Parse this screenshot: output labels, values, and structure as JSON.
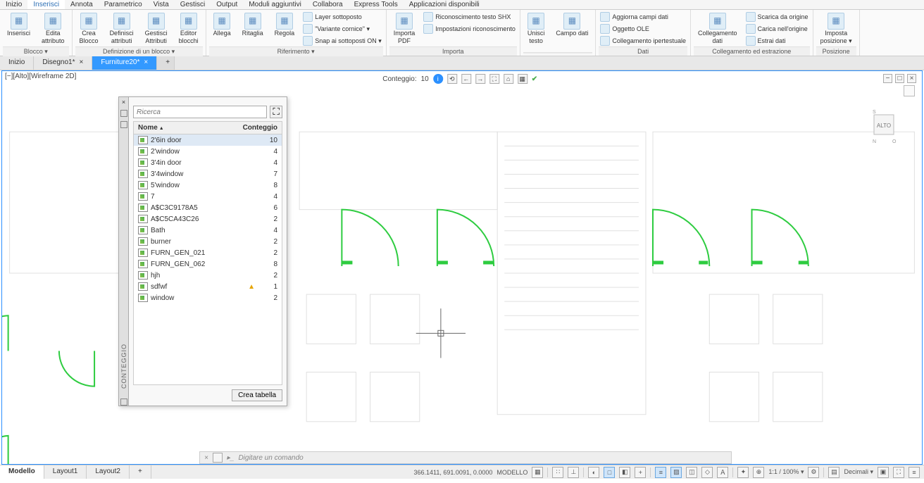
{
  "menu": [
    "Inizio",
    "Inserisci",
    "Annota",
    "Parametrico",
    "Vista",
    "Gestisci",
    "Output",
    "Moduli aggiuntivi",
    "Collabora",
    "Express Tools",
    "Applicazioni disponibili"
  ],
  "menu_active": 1,
  "ribbon": {
    "panels": [
      {
        "title": "Blocco ▾",
        "items_big": [
          [
            "Inserisci",
            ""
          ],
          [
            "Edita",
            "attributo"
          ]
        ]
      },
      {
        "title": "Definizione di un blocco ▾",
        "items_big": [
          [
            "Crea",
            "Blocco"
          ],
          [
            "Definisci",
            "attributi"
          ],
          [
            "Gestisci",
            "Attributi"
          ],
          [
            "Editor",
            "blocchi"
          ]
        ]
      },
      {
        "title": "Riferimento ▾",
        "items_big": [
          [
            "Allega",
            ""
          ],
          [
            "Ritaglia",
            ""
          ],
          [
            "Regola",
            ""
          ]
        ],
        "items_small": [
          "Layer sottoposto",
          "\"Variante cornice\" ▾",
          "Snap ai sottoposti ON ▾"
        ]
      },
      {
        "title": "Importa",
        "items_big": [
          [
            "Importa",
            "PDF"
          ]
        ],
        "items_small": [
          "Riconoscimento testo SHX",
          "Impostazioni riconoscimento"
        ]
      },
      {
        "title": "",
        "items_big": [
          [
            "Unisci",
            "testo"
          ],
          [
            "Campo dati",
            ""
          ]
        ]
      },
      {
        "title": "Dati",
        "items_small": [
          "Aggiorna campi dati",
          "Oggetto OLE",
          "Collegamento ipertestuale"
        ]
      },
      {
        "title": "Collegamento ed estrazione",
        "items_big": [
          [
            "Collegamento",
            "dati"
          ]
        ],
        "items_small": [
          "Scarica da origine",
          "Carica nell'origine",
          "Estrai dati"
        ]
      },
      {
        "title": "Posizione",
        "items_big": [
          [
            "Imposta",
            "posizione ▾"
          ]
        ]
      }
    ]
  },
  "doc_tabs": [
    {
      "label": "Inizio",
      "closable": false
    },
    {
      "label": "Disegno1*",
      "closable": true
    },
    {
      "label": "Furniture20*",
      "closable": true
    }
  ],
  "doc_tab_active": 2,
  "viewport_label": "[−][Alto][Wireframe 2D]",
  "count_bar": {
    "label": "Conteggio:",
    "value": "10"
  },
  "palette": {
    "vertical_label": "CONTEGGIO",
    "search_placeholder": "Ricerca",
    "head_name": "Nome",
    "head_count": "Conteggio",
    "rows": [
      {
        "name": "2'6in door",
        "count": "10",
        "sel": true,
        "warn": false
      },
      {
        "name": "2'window",
        "count": "4",
        "sel": false,
        "warn": false
      },
      {
        "name": "3'4in door",
        "count": "4",
        "sel": false,
        "warn": false
      },
      {
        "name": "3'4window",
        "count": "7",
        "sel": false,
        "warn": false
      },
      {
        "name": "5'window",
        "count": "8",
        "sel": false,
        "warn": false
      },
      {
        "name": "7",
        "count": "4",
        "sel": false,
        "warn": false
      },
      {
        "name": "A$C3C9178A5",
        "count": "6",
        "sel": false,
        "warn": false
      },
      {
        "name": "A$C5CA43C26",
        "count": "2",
        "sel": false,
        "warn": false
      },
      {
        "name": "Bath",
        "count": "4",
        "sel": false,
        "warn": false
      },
      {
        "name": "burner",
        "count": "2",
        "sel": false,
        "warn": false
      },
      {
        "name": "FURN_GEN_021",
        "count": "2",
        "sel": false,
        "warn": false
      },
      {
        "name": "FURN_GEN_062",
        "count": "8",
        "sel": false,
        "warn": false
      },
      {
        "name": "hjh",
        "count": "2",
        "sel": false,
        "warn": false
      },
      {
        "name": "sdfwf",
        "count": "1",
        "sel": false,
        "warn": true
      },
      {
        "name": "window",
        "count": "2",
        "sel": false,
        "warn": false
      }
    ],
    "button": "Crea tabella"
  },
  "cmdline": "Digitare un comando",
  "layout_tabs": [
    "Modello",
    "Layout1",
    "Layout2"
  ],
  "layout_tab_active": 0,
  "status": {
    "coords": "366.1411, 691.0091, 0.0000",
    "space": "MODELLO",
    "scale": "1:1 / 100% ▾",
    "units": "Decimali ▾"
  },
  "viewcube": {
    "face": "ALTO"
  }
}
